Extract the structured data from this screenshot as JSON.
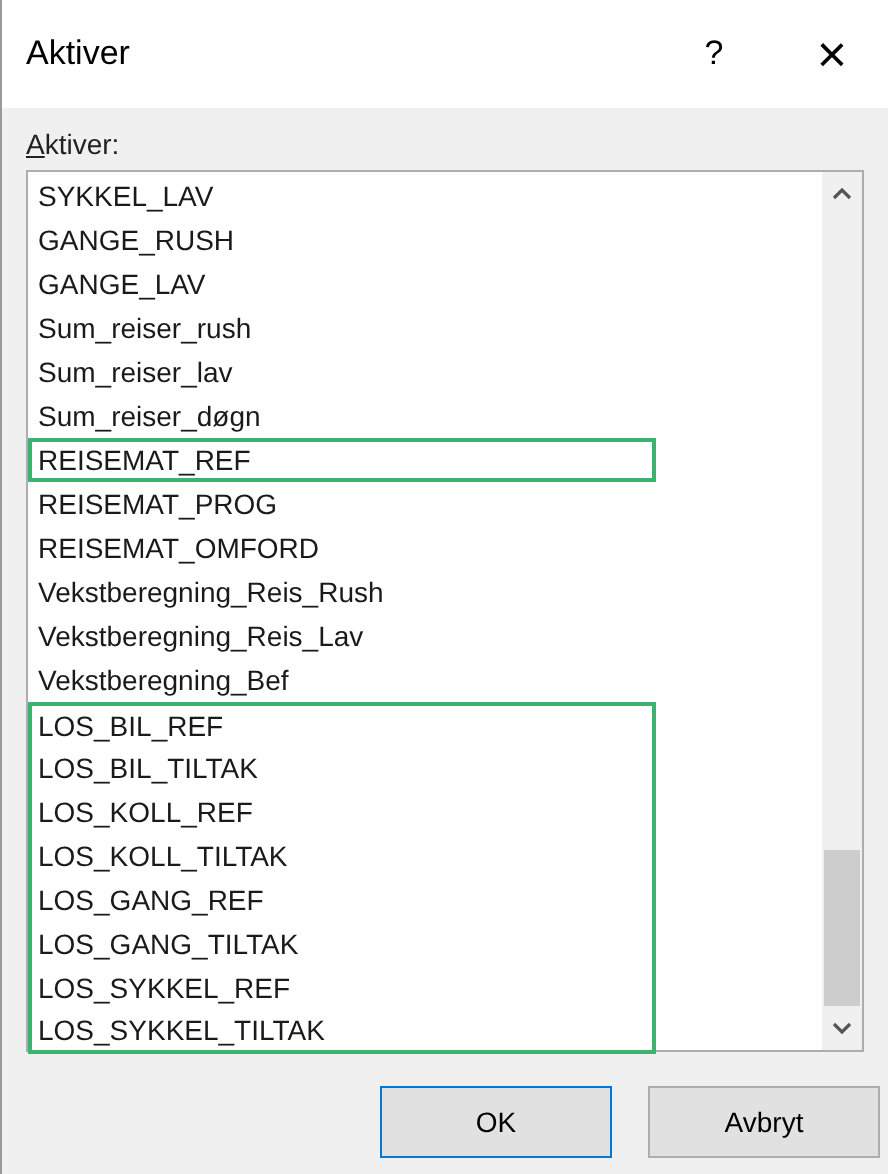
{
  "window": {
    "title": "Aktiver",
    "help": "?",
    "close": "×"
  },
  "list_label": {
    "access_key": "A",
    "rest": "ktiver:"
  },
  "items": [
    {
      "text": "SYKKEL_LAV",
      "highlighted": false
    },
    {
      "text": "GANGE_RUSH",
      "highlighted": false
    },
    {
      "text": "GANGE_LAV",
      "highlighted": false
    },
    {
      "text": "Sum_reiser_rush",
      "highlighted": false
    },
    {
      "text": "Sum_reiser_lav",
      "highlighted": false
    },
    {
      "text": "Sum_reiser_døgn",
      "highlighted": false
    },
    {
      "text": "REISEMAT_REF",
      "highlighted": true
    },
    {
      "text": "REISEMAT_PROG",
      "highlighted": false
    },
    {
      "text": "REISEMAT_OMFORD",
      "highlighted": false
    },
    {
      "text": "Vekstberegning_Reis_Rush",
      "highlighted": false
    },
    {
      "text": "Vekstberegning_Reis_Lav",
      "highlighted": false
    },
    {
      "text": "Vekstberegning_Bef",
      "highlighted": false
    },
    {
      "text": "LOS_BIL_REF",
      "highlighted": true
    },
    {
      "text": "LOS_BIL_TILTAK",
      "highlighted": true
    },
    {
      "text": "LOS_KOLL_REF",
      "highlighted": true
    },
    {
      "text": "LOS_KOLL_TILTAK",
      "highlighted": true
    },
    {
      "text": "LOS_GANG_REF",
      "highlighted": true
    },
    {
      "text": "LOS_GANG_TILTAK",
      "highlighted": true
    },
    {
      "text": "LOS_SYKKEL_REF",
      "highlighted": true
    },
    {
      "text": "LOS_SYKKEL_TILTAK",
      "highlighted": true
    }
  ],
  "buttons": [
    {
      "label": "OK",
      "default": true
    },
    {
      "label": "Avbryt",
      "default": false
    }
  ]
}
